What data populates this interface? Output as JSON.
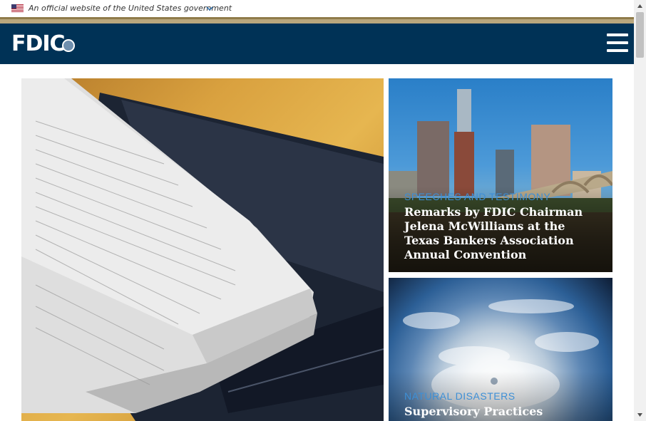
{
  "gov_banner": {
    "text": "An official website of the United States government"
  },
  "header": {
    "logo_text": "FDIC",
    "menu_icon": "hamburger-menu-icon"
  },
  "colors": {
    "header_bg": "#003256",
    "gold_line": "#8f7b4a",
    "tan_band": "#b9a77d",
    "category_blue": "#3d8fd6"
  },
  "hero": {
    "image": "newspaper-financial-pages-on-portfolio"
  },
  "cards": [
    {
      "category": "SPEECHES AND TESTIMONY",
      "title": "Remarks by FDIC Chairman Jelena McWilliams at the Texas Bankers Association Annual Convention",
      "image": "austin-skyline"
    },
    {
      "category": "NATURAL DISASTERS",
      "title": "Supervisory Practices",
      "image": "hurricane-from-space"
    }
  ]
}
